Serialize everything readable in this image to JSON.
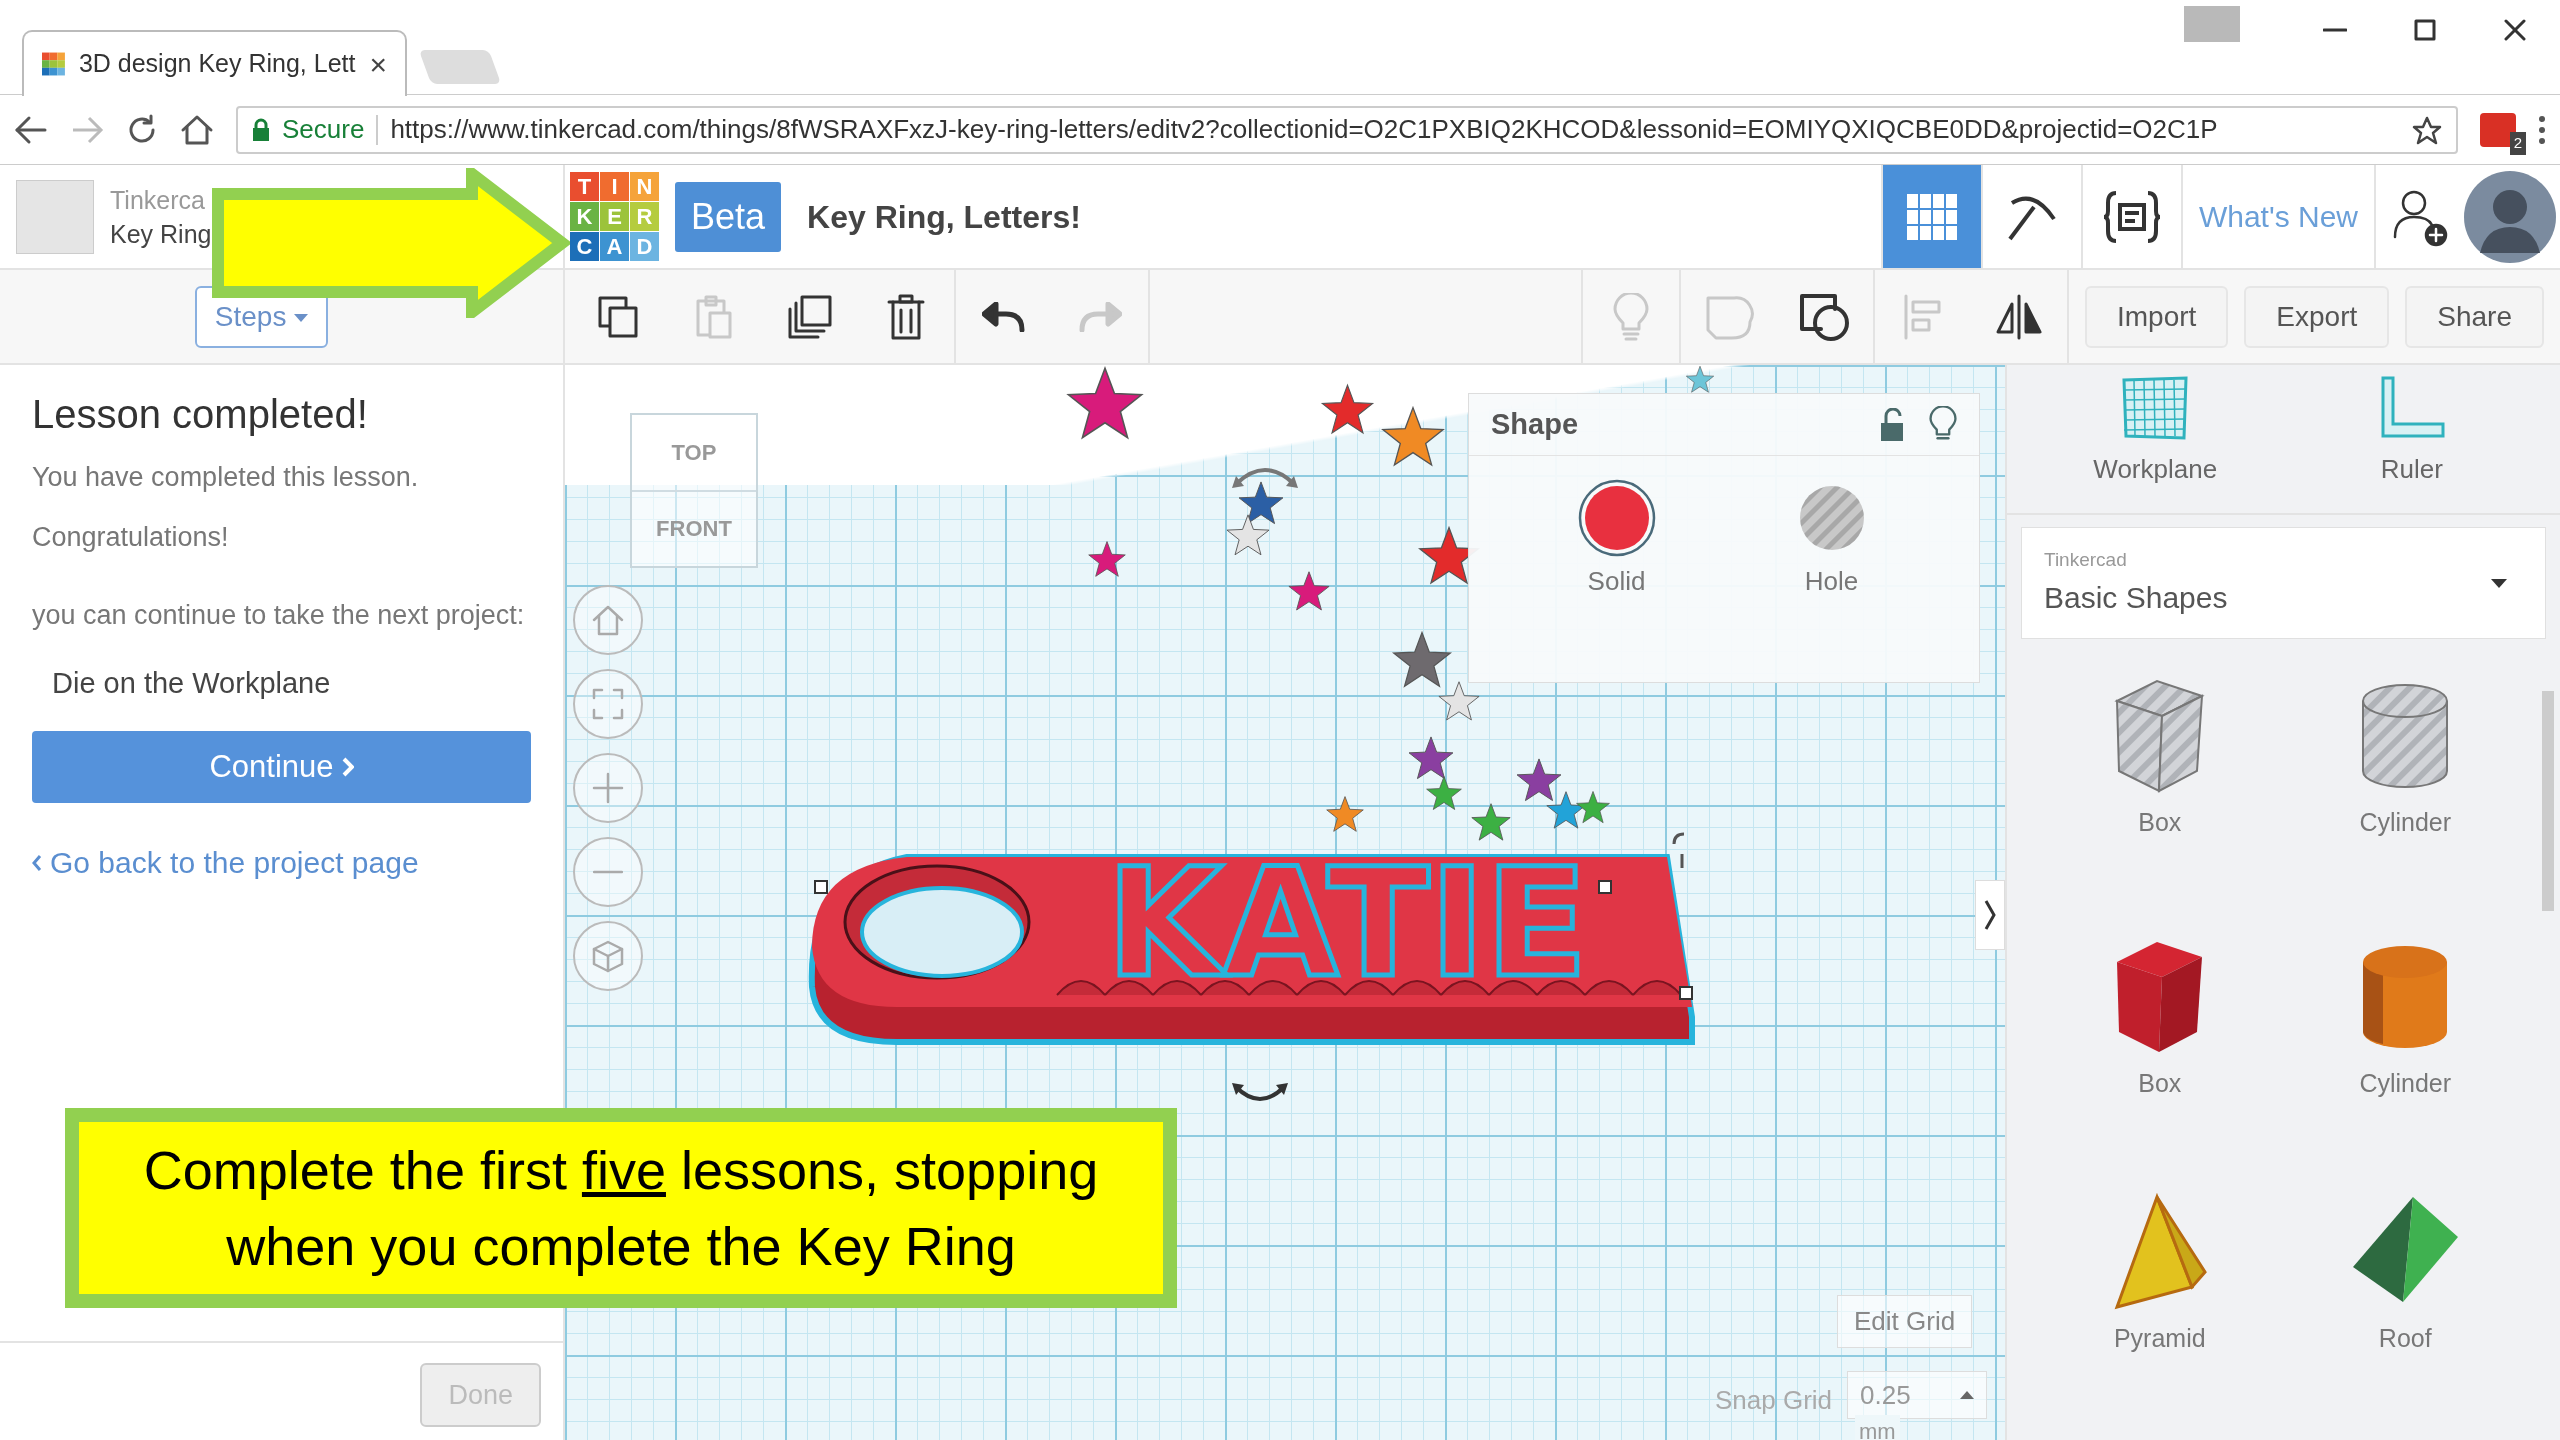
{
  "browser": {
    "tab": {
      "title": "3D design Key Ring, Lett",
      "close": "×"
    },
    "forward_disabled": true,
    "address": {
      "secure": "Secure",
      "url": "https://www.tinkercad.com/things/8fWSRAXFxzJ-key-ring-letters/editv2?collectionid=O2C1PXBIQ2KHCOD&lessonid=EOMIYQXIQCBE0DD&projectid=O2C1P"
    },
    "extension_count": "2"
  },
  "header": {
    "user": {
      "line1": "Tinkerca",
      "line2": "Key Ring"
    },
    "logo": [
      "T",
      "I",
      "N",
      "K",
      "E",
      "R",
      "C",
      "A",
      "D"
    ],
    "badge": "Beta",
    "title": "Key Ring, Letters!",
    "nav": [
      {
        "kind": "grid",
        "selected": true
      },
      {
        "kind": "pickaxe",
        "selected": false
      },
      {
        "kind": "code",
        "selected": false
      }
    ],
    "whats_new": "What's New"
  },
  "toolbar": {
    "steps": "Steps",
    "tools": [
      {
        "kind": "copy",
        "disabled": false
      },
      {
        "kind": "paste",
        "disabled": true
      },
      {
        "kind": "duplicate",
        "disabled": false
      },
      {
        "kind": "delete",
        "disabled": false
      },
      {
        "kind": "undo",
        "disabled": false
      },
      {
        "kind": "redo",
        "disabled": true
      }
    ],
    "view_tools": [
      {
        "kind": "bulb",
        "disabled": true
      },
      {
        "kind": "shape",
        "disabled": true
      },
      {
        "kind": "group",
        "disabled": false
      },
      {
        "kind": "align",
        "disabled": true
      },
      {
        "kind": "mirror",
        "disabled": false
      }
    ],
    "buttons": [
      "Import",
      "Export",
      "Share"
    ]
  },
  "lesson": {
    "heading": "Lesson completed!",
    "paragraphs": [
      "You have completed this lesson.",
      "Congratulations!",
      "you can continue to take the next project:"
    ],
    "next_project": "Die on the Workplane",
    "continue": "Continue",
    "back_link": "Go back to the project page",
    "done": {
      "label": "Done",
      "disabled": true
    }
  },
  "viewport": {
    "view_cube": {
      "top": "TOP",
      "front": "FRONT"
    },
    "model_text": "KATIE",
    "inspector": {
      "title": "Shape",
      "options": [
        {
          "kind": "solid",
          "label": "Solid",
          "selected": true
        },
        {
          "kind": "hole",
          "label": "Hole",
          "selected": false
        }
      ]
    },
    "edit_grid": "Edit Grid",
    "snap": {
      "label": "Snap Grid",
      "value": "0.25",
      "unit": "mm"
    }
  },
  "library": {
    "tools": [
      {
        "kind": "workplane",
        "label": "Workplane"
      },
      {
        "kind": "ruler",
        "label": "Ruler"
      }
    ],
    "source": "Tinkercad",
    "name": "Basic Shapes",
    "shapes": [
      {
        "kind": "box-hole",
        "label": "Box"
      },
      {
        "kind": "cylinder-hole",
        "label": "Cylinder"
      },
      {
        "kind": "box",
        "label": "Box"
      },
      {
        "kind": "cylinder",
        "label": "Cylinder"
      },
      {
        "kind": "pyramid",
        "label": "Pyramid"
      },
      {
        "kind": "roof",
        "label": "Roof"
      }
    ]
  },
  "callout": {
    "segments": [
      {
        "text": "Complete the first ",
        "underline": false
      },
      {
        "text": "five",
        "underline": true
      },
      {
        "text": " lessons, stopping when you complete the Key Ring",
        "underline": false
      }
    ]
  }
}
